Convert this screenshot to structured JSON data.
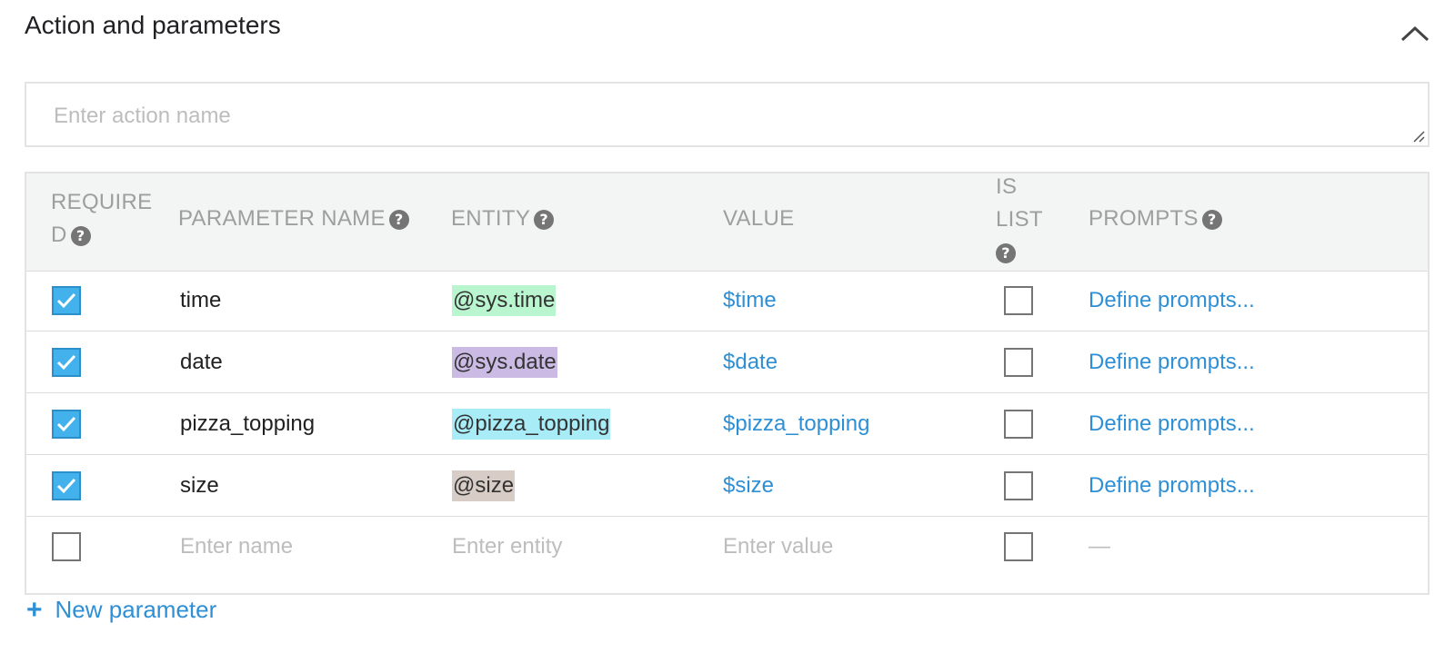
{
  "section": {
    "title": "Action and parameters"
  },
  "action": {
    "placeholder": "Enter action name",
    "value": ""
  },
  "table": {
    "headers": {
      "required_l1": "REQUIRE",
      "required_l2": "D",
      "parameter_name": "PARAMETER NAME",
      "entity": "ENTITY",
      "value": "VALUE",
      "is_list_l1": "IS",
      "is_list_l2": "LIST",
      "prompts": "PROMPTS"
    },
    "rows": [
      {
        "required": true,
        "name": "time",
        "entity": "@sys.time",
        "entity_color": "#b9f5cf",
        "value": "$time",
        "is_list": false,
        "prompts": "Define prompts..."
      },
      {
        "required": true,
        "name": "date",
        "entity": "@sys.date",
        "entity_color": "#cbbbe4",
        "value": "$date",
        "is_list": false,
        "prompts": "Define prompts..."
      },
      {
        "required": true,
        "name": "pizza_topping",
        "entity": "@pizza_topping",
        "entity_color": "#a8ecf7",
        "value": "$pizza_topping",
        "is_list": false,
        "prompts": "Define prompts..."
      },
      {
        "required": true,
        "name": "size",
        "entity": "@size",
        "entity_color": "#d8ccc6",
        "value": "$size",
        "is_list": false,
        "prompts": "Define prompts..."
      }
    ],
    "new_row": {
      "required": false,
      "name_placeholder": "Enter name",
      "entity_placeholder": "Enter entity",
      "value_placeholder": "Enter value",
      "is_list": false,
      "prompts": "—"
    }
  },
  "new_parameter": {
    "label": "New parameter",
    "icon": "plus-icon"
  },
  "colors": {
    "accent": "#2e8fd5",
    "checkbox": "#43b2ec",
    "header_bg": "#f3f4f4"
  }
}
